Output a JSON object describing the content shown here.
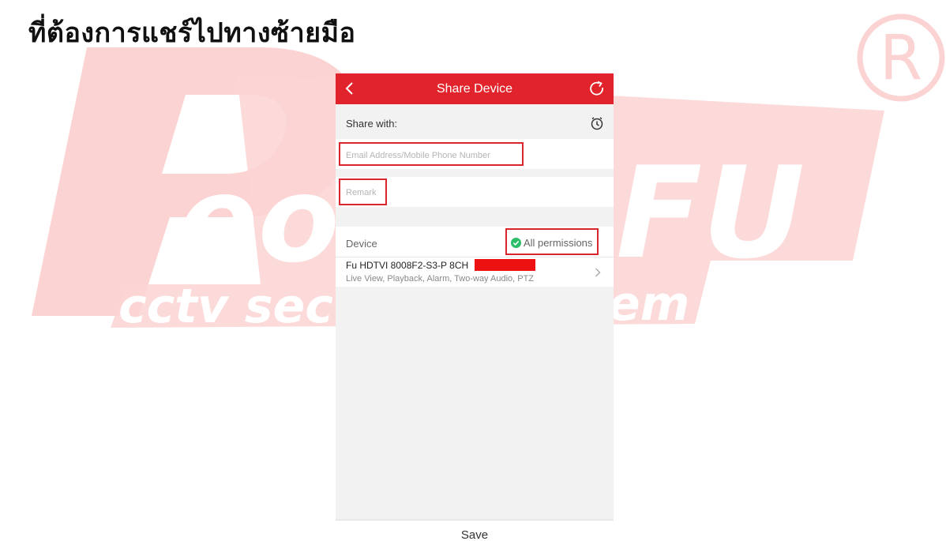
{
  "slide": {
    "heading": "ที่ต้องการแชร์ไปทางซ้ายมือ"
  },
  "watermark": {
    "brand_line1": "PeoFU",
    "brand_line2": "cctv security system",
    "registered_mark": "R"
  },
  "app": {
    "header": {
      "title": "Share Device",
      "back_icon": "chevron-left-icon",
      "refresh_icon": "refresh-icon"
    },
    "share_with": {
      "label": "Share with:",
      "icon": "clock-icon"
    },
    "email_input": {
      "value": "",
      "placeholder": "Email Address/Mobile Phone Number"
    },
    "remark_input": {
      "value": "",
      "placeholder": "Remark"
    },
    "device_section": {
      "label": "Device",
      "permissions": "All permissions",
      "permissions_icon": "check-circle-icon"
    },
    "device_item": {
      "name": "Fu HDTVI 8008F2-S3-P 8CH",
      "permissions": "Live View, Playback, Alarm, Two-way Audio, PTZ"
    },
    "footer": {
      "save_label": "Save"
    }
  },
  "colors": {
    "header_red": "#e1242b",
    "highlight_box": "#d8262c",
    "check_green": "#2bbd6a",
    "watermark_pink": "#fbd3d3"
  }
}
